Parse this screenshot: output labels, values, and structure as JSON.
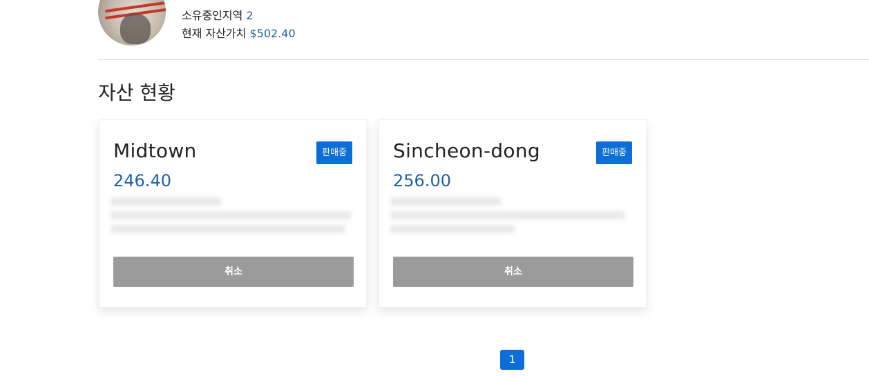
{
  "profile": {
    "owned_regions_label": "소유중인지역",
    "owned_regions_value": "2",
    "asset_value_label": "현재 자산가치",
    "asset_value_value": "$502.40"
  },
  "section": {
    "title": "자산 현황"
  },
  "cards": [
    {
      "name": "Midtown",
      "badge": "판매중",
      "price": "246.40",
      "cancel_label": "취소"
    },
    {
      "name": "Sincheon-dong",
      "badge": "판매중",
      "price": "256.00",
      "cancel_label": "취소"
    }
  ],
  "pagination": {
    "current_page": "1"
  },
  "colors": {
    "accent": "#0d6ed8",
    "price": "#1d5fa8",
    "cancel_button": "#9b9b9b"
  }
}
